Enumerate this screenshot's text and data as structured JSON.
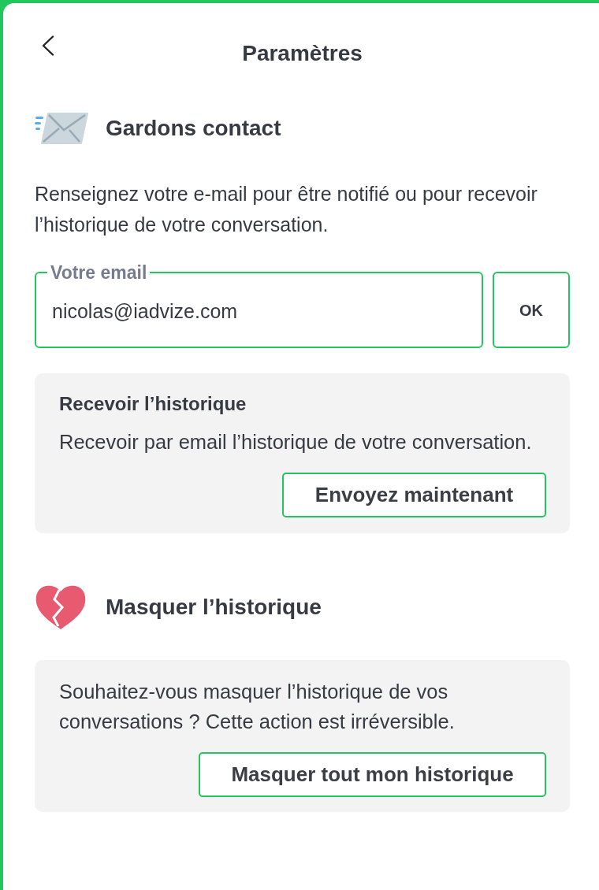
{
  "header": {
    "title": "Paramètres"
  },
  "contact_section": {
    "title": "Gardons contact",
    "description": "Renseignez votre e-mail pour être notifié ou pour recevoir l’historique de votre conversation.",
    "email_field": {
      "label": "Votre email",
      "value": "nicolas@iadvize.com"
    },
    "submit_button": "OK",
    "history_card": {
      "title": "Recevoir l’historique",
      "text": "Recevoir par email l’historique de votre conversation.",
      "button": "Envoyez maintenant"
    }
  },
  "hide_section": {
    "title": "Masquer l’historique",
    "card": {
      "text": "Souhaitez-vous masquer l’historique de vos conversations ? Cette action est irréversible.",
      "button": "Masquer tout mon historique"
    }
  }
}
